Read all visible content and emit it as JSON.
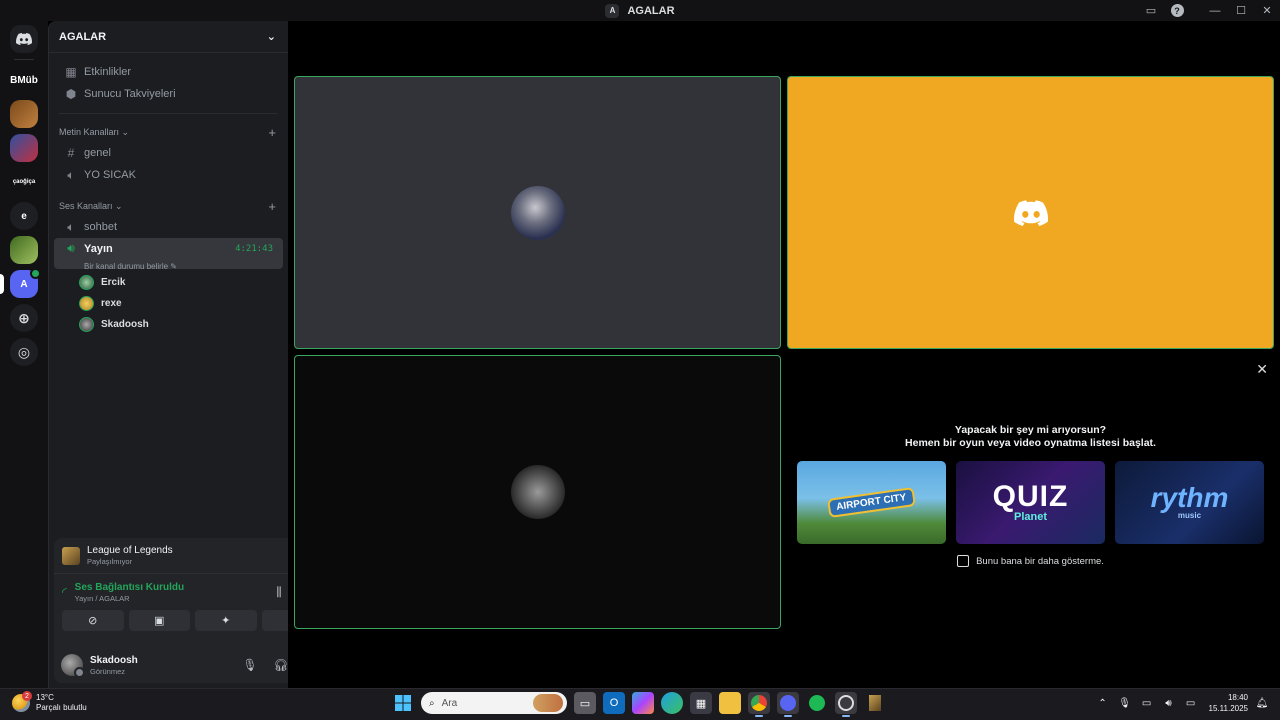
{
  "window": {
    "title": "AGALAR",
    "server_initial": "A"
  },
  "rail": {
    "servers": [
      {
        "name": "home",
        "label": ""
      },
      {
        "name": "bmub",
        "label": "BMüb"
      },
      {
        "name": "server-img-1",
        "label": ""
      },
      {
        "name": "server-img-2",
        "label": ""
      },
      {
        "name": "server-text-1",
        "label": "çaoğiça"
      },
      {
        "name": "server-e",
        "label": "e"
      },
      {
        "name": "server-img-3",
        "label": ""
      },
      {
        "name": "server-agalar",
        "label": "A"
      }
    ]
  },
  "sidebar": {
    "server_name": "AGALAR",
    "events_label": "Etkinlikler",
    "boosts_label": "Sunucu Takviyeleri",
    "text_category": "Metin Kanalları",
    "text_channels": [
      "genel",
      "YO SICAK"
    ],
    "voice_category": "Ses Kanalları",
    "voice_channels": [
      "sohbet"
    ],
    "active_voice": {
      "name": "Yayın",
      "timer": "4:21:43",
      "status": "Bir kanal durumu belirle"
    },
    "voice_users": [
      "Ercik",
      "rexe",
      "Skadoosh"
    ]
  },
  "activity": {
    "game": "League of Legends",
    "sub": "Paylaşılmıyor"
  },
  "voice": {
    "status": "Ses Bağlantısı Kuruldu",
    "channel": "Yayın / AGALAR"
  },
  "user": {
    "name": "Skadoosh",
    "status": "Görünmez"
  },
  "suggest": {
    "line1": "Yapacak bir şey mi arıyorsun?",
    "line2": "Hemen bir oyun veya video oynatma listesi başlat.",
    "activities": [
      {
        "title": "AIRPORT CITY",
        "sub": ""
      },
      {
        "title": "QUIZ",
        "sub": "Planet"
      },
      {
        "title": "rythm",
        "sub": "music"
      }
    ],
    "dont_show": "Bunu bana bir daha gösterme."
  },
  "taskbar": {
    "weather_temp": "13°C",
    "weather_desc": "Parçalı bulutlu",
    "weather_badge": "2",
    "search_placeholder": "Ara",
    "time": "18:40",
    "date": "15.11.2025"
  },
  "colors": {
    "accent": "#5865f2",
    "speaking": "#3ba55d",
    "online": "#23a55a",
    "tile_orange": "#f0a823"
  }
}
